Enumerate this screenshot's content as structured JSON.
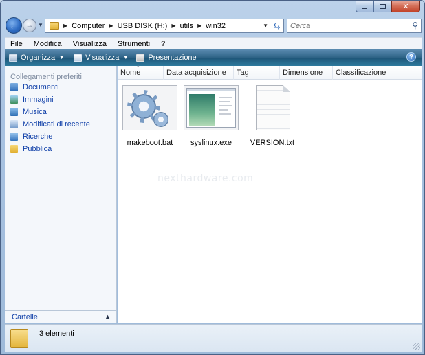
{
  "window": {
    "caption_buttons": [
      "minimize",
      "maximize",
      "close"
    ]
  },
  "navbar": {
    "breadcrumb": [
      "Computer",
      "USB DISK (H:)",
      "utils",
      "win32"
    ],
    "search_placeholder": "Cerca"
  },
  "menubar": {
    "items": [
      "File",
      "Modifica",
      "Visualizza",
      "Strumenti",
      "?"
    ]
  },
  "commandbar": {
    "organize": "Organizza",
    "view": "Visualizza",
    "slideshow": "Presentazione"
  },
  "leftpane": {
    "header": "Collegamenti preferiti",
    "items": [
      {
        "label": "Documenti",
        "icon": "documents-icon"
      },
      {
        "label": "Immagini",
        "icon": "pictures-icon"
      },
      {
        "label": "Musica",
        "icon": "music-icon"
      },
      {
        "label": "Modificati di recente",
        "icon": "recent-icon"
      },
      {
        "label": "Ricerche",
        "icon": "search-folder-icon"
      },
      {
        "label": "Pubblica",
        "icon": "public-folder-icon"
      }
    ],
    "folders_label": "Cartelle"
  },
  "columns": [
    "Nome",
    "Data acquisizione",
    "Tag",
    "Dimensione",
    "Classificazione"
  ],
  "files": [
    {
      "name": "makeboot.bat",
      "icon": "batch-gear-icon"
    },
    {
      "name": "syslinux.exe",
      "icon": "executable-icon"
    },
    {
      "name": "VERSION.txt",
      "icon": "text-file-icon"
    }
  ],
  "watermark": "nexthardware.com",
  "status": {
    "count": "3 elementi"
  },
  "colors": {
    "link": "#0f3fa8",
    "commandbar": "#1e5578",
    "frame": "#a9c3e2"
  }
}
